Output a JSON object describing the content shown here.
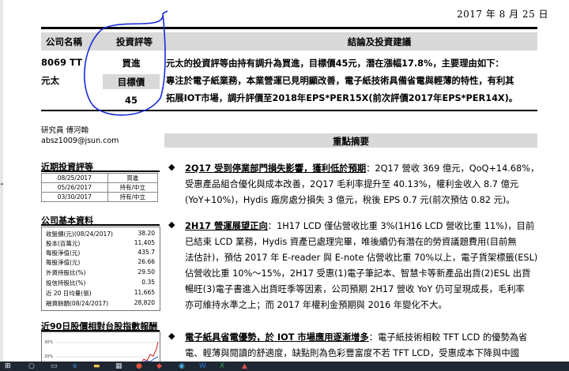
{
  "report_date": "2017 年 8 月 25 日",
  "header": {
    "col_company": "公司名稱",
    "col_rating": "投資評等",
    "col_conclusion": "結論及投資建議"
  },
  "stock": {
    "code": "8069 TT",
    "name": "元太",
    "rating": "買進",
    "target_label": "目標價",
    "target_price": "45"
  },
  "conclusion_lines": [
    "元太的投資評等由持有調升為買進，目標價45元，潛在漲幅17.8%，主要理由如下：",
    "專注於電子紙業務，本業營運已見明顯改善，電子紙技術具備省電與輕薄的特性，有利其",
    "拓展IOT市場，調升評價至2018年EPS*PER15X(前次評價2017年EPS*PER14X)。"
  ],
  "analyst": {
    "label": "研究員  傅河翰",
    "email": "absz1009@jsun.com"
  },
  "summary_title": "重點摘要",
  "rating_history": {
    "title": "近期投資評等",
    "rows": [
      {
        "date": "08/25/2017",
        "rating": "買進"
      },
      {
        "date": "05/26/2017",
        "rating": "持有/中立"
      },
      {
        "date": "03/30/2017",
        "rating": "持有/中立"
      }
    ]
  },
  "basic_info": {
    "title": "公司基本資料",
    "rows": [
      {
        "label": "收盤價(元)(08/24/2017)",
        "value": "38.20"
      },
      {
        "label": "股本(百萬元)",
        "value": "11,405"
      },
      {
        "label": "每股淨值(元)",
        "value": "435.7"
      },
      {
        "label": "每股淨值(元)",
        "value": "26.66"
      },
      {
        "label": "外資持股比(%)",
        "value": "29.50"
      },
      {
        "label": "投信持股比(%)",
        "value": "0.35"
      },
      {
        "label": "近 20 日均量(張)",
        "value": "11,665"
      },
      {
        "label": "融資餘額(08/24/2017)",
        "value": "28,820"
      }
    ]
  },
  "chart_section": {
    "title": "近90日股價相對台股指數報酬",
    "ticks": [
      "30%",
      "20%"
    ]
  },
  "paragraphs": [
    {
      "headline": "2Q17 受到停業部門損失影響，獲利低於預期",
      "lines": [
        "：2Q17 營收 369 億元，QoQ+14.68%，",
        "受惠產品組合優化與成本改善，2Q17 毛利率提升至 40.13%，權利金收入 8.7 億元",
        "(YoY+10%)，Hydis 廠房處分損失 3 億元，稅後 EPS 0.7 元(前次預估 0.82 元)。"
      ]
    },
    {
      "headline": "2H17 營運展望正向",
      "lines": [
        "：1H17 LCD 僅佔營收比重 3%(1H16 LCD 營收比重 11%)，目前",
        "已結束 LCD 業務，Hydis 資產已處理完畢，唯後續仍有潛在的勞資議題費用(目前無",
        "法估計)，預估 2017 年 E-reader 與 E-note 佔營收比重 70%以上，電子貨架標籤(ESL)",
        "佔營收比重 10%～15%，2H17 受惠(1)電子筆記本、智慧卡等新產品出貨(2)ESL 出貨",
        "暢旺(3)電子書進入出貨旺季等因素，公司預期 2H17 營收 YoY 仍可呈現成長，毛利率",
        "亦可維持水準之上；而 2017 年權利金預期與 2016 年變化不大。"
      ]
    },
    {
      "headline": "電子紙具省電優勢，於 IOT 市場應用逐漸增多",
      "lines": [
        "：電子紙技術相較 TFT LCD 的優勢為省",
        "電、輕薄與閱讀的舒適度，缺點則為色彩豐富度不若 TFT LCD，受惠成本下降與中國"
      ]
    }
  ]
}
